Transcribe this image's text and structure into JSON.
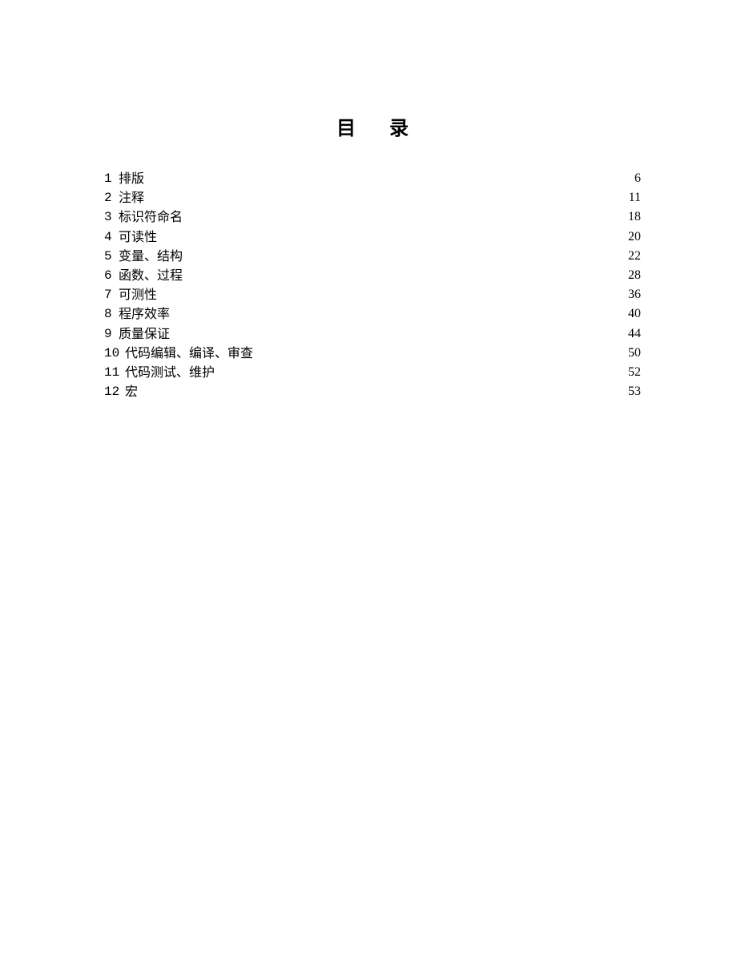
{
  "heading": "目 录",
  "toc": [
    {
      "num": "1",
      "title": "排版",
      "page": "6"
    },
    {
      "num": "2",
      "title": "注释",
      "page": "11"
    },
    {
      "num": "3",
      "title": "标识符命名",
      "page": "18"
    },
    {
      "num": "4",
      "title": "可读性",
      "page": "20"
    },
    {
      "num": "5",
      "title": "变量、结构",
      "page": "22"
    },
    {
      "num": "6",
      "title": "函数、过程",
      "page": "28"
    },
    {
      "num": "7",
      "title": "可测性",
      "page": "36"
    },
    {
      "num": "8",
      "title": "程序效率",
      "page": "40"
    },
    {
      "num": "9",
      "title": "质量保证",
      "page": "44"
    },
    {
      "num": "10",
      "title": "代码编辑、编译、审查",
      "page": "50"
    },
    {
      "num": "11",
      "title": "代码测试、维护",
      "page": "52"
    },
    {
      "num": "12",
      "title": "宏",
      "page": "53"
    }
  ]
}
